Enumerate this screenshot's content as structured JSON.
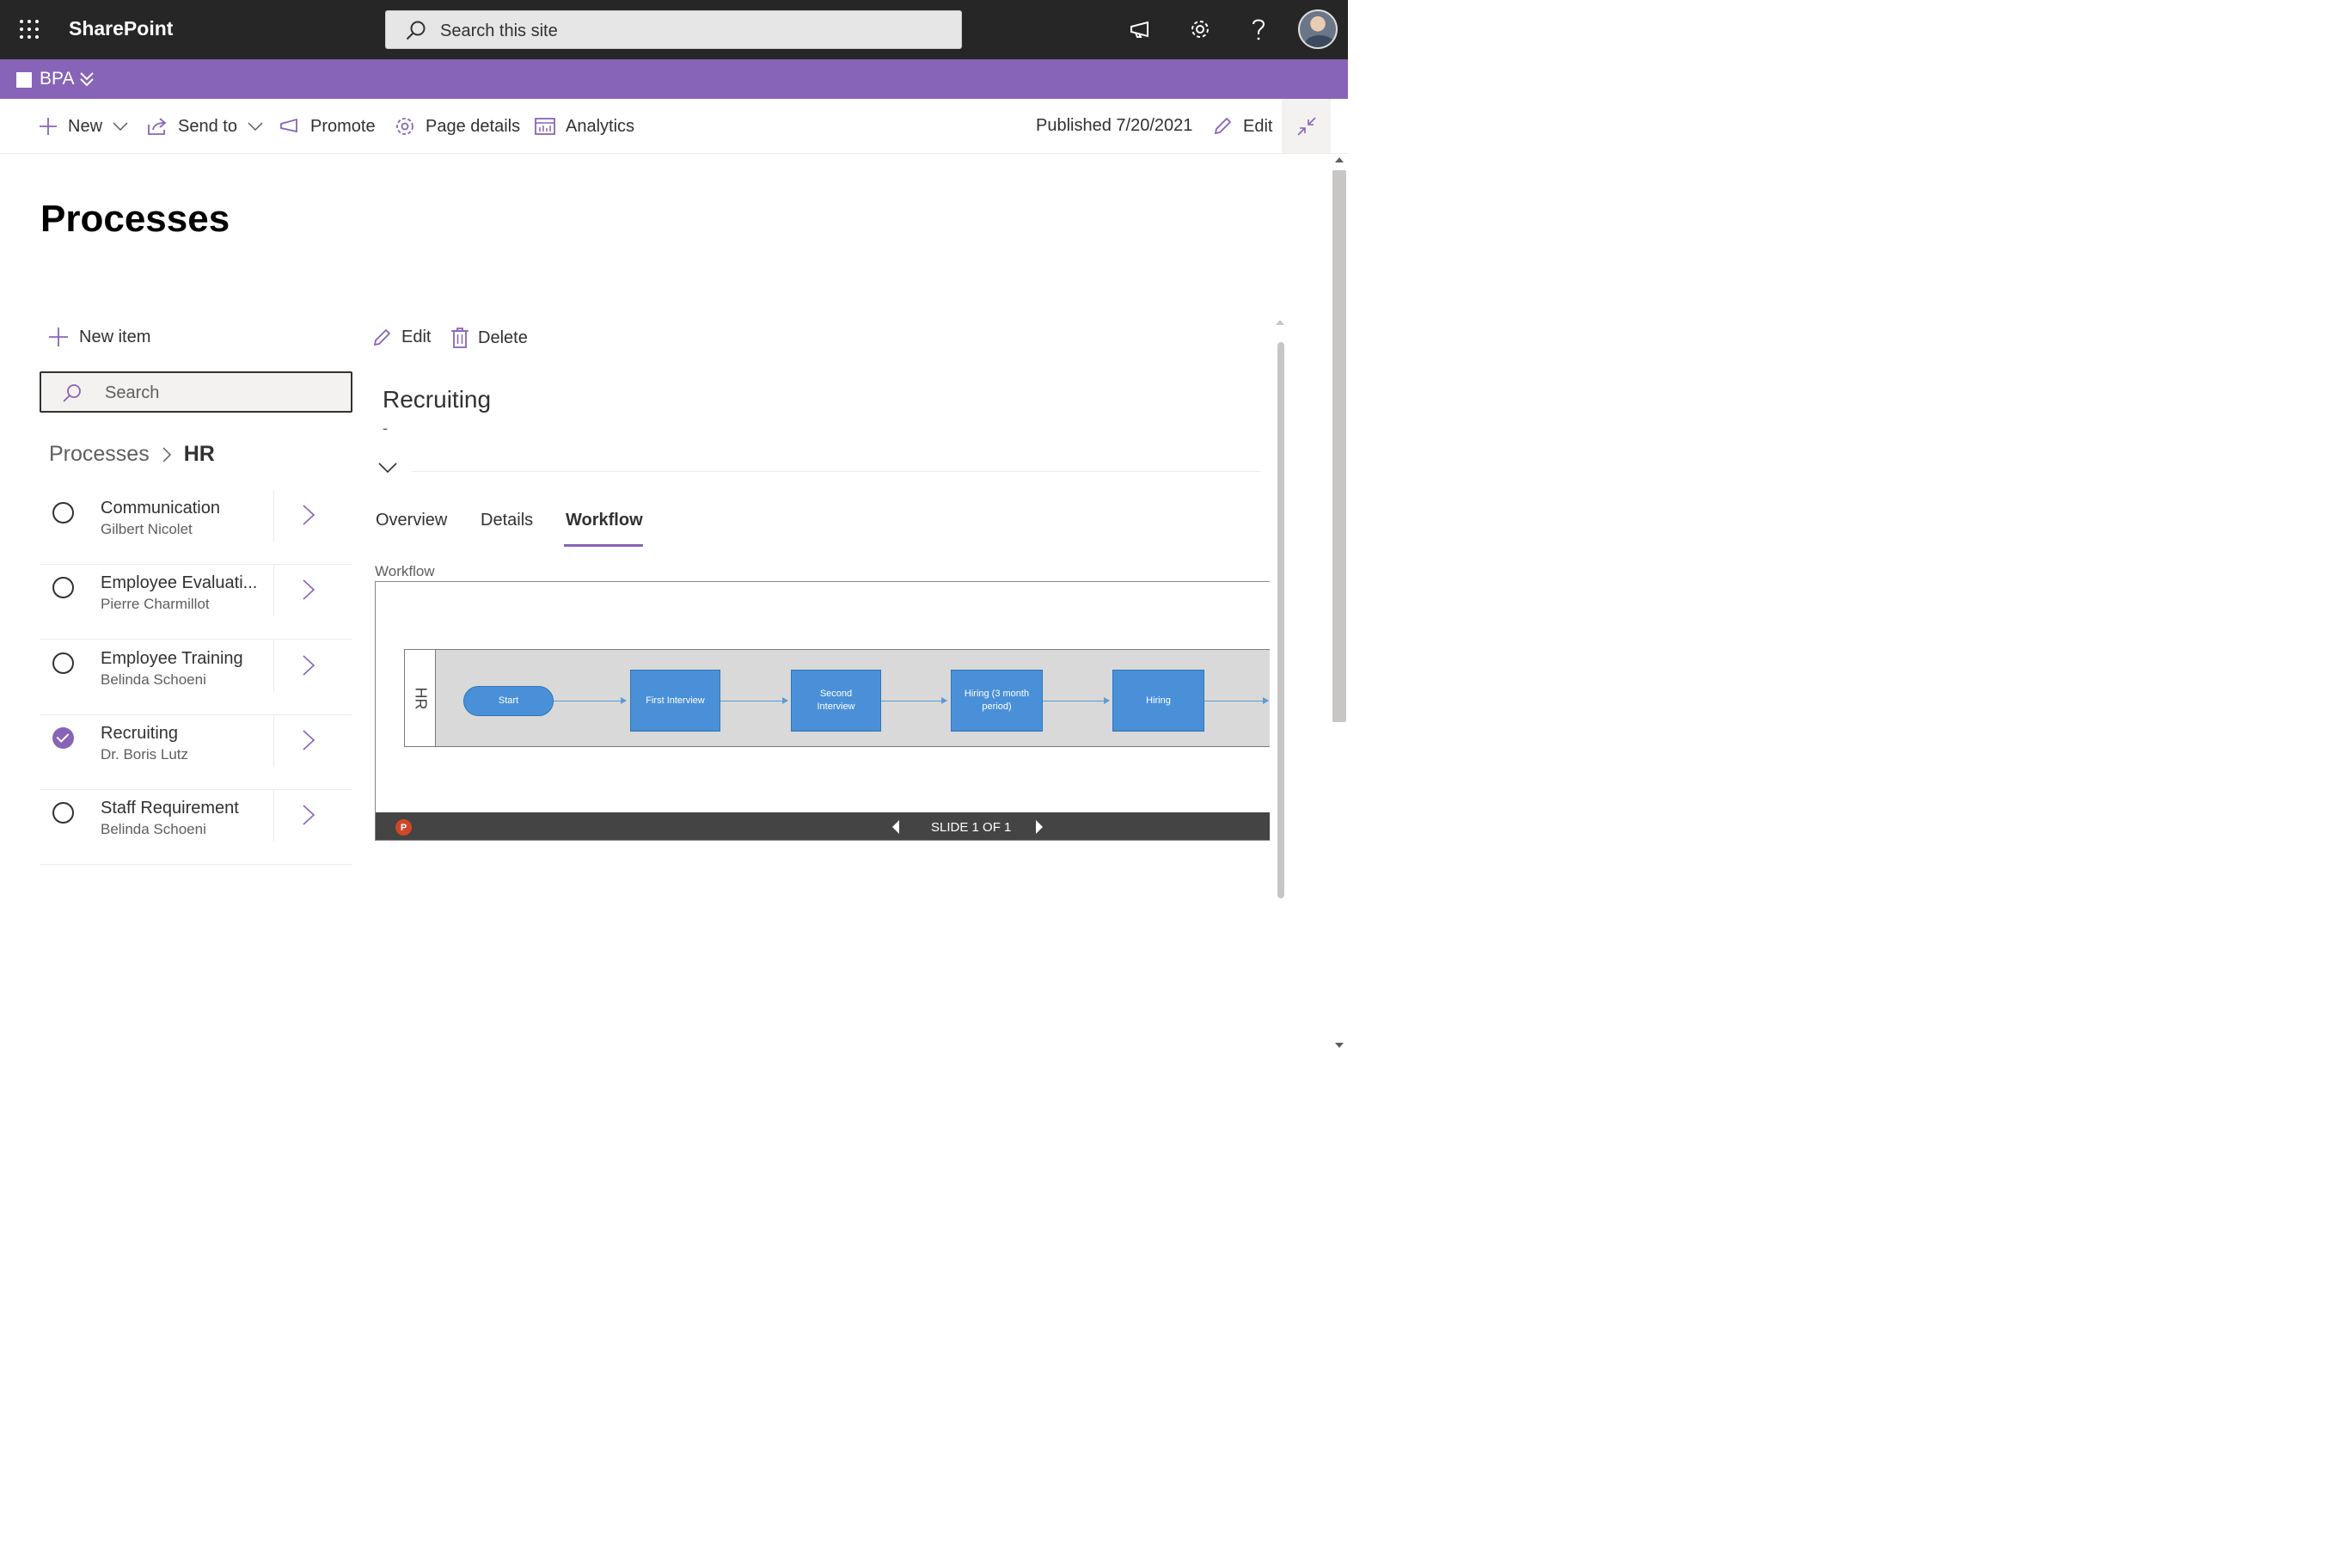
{
  "suite": {
    "brand": "SharePoint",
    "search_placeholder": "Search this site",
    "icons": [
      "app-launcher-icon",
      "megaphone-icon",
      "gear-icon",
      "help-icon",
      "avatar"
    ]
  },
  "hub": {
    "name": "BPA"
  },
  "command_bar": {
    "new": "New",
    "send_to": "Send to",
    "promote": "Promote",
    "page_details": "Page details",
    "analytics": "Analytics",
    "published": "Published 7/20/2021",
    "edit": "Edit"
  },
  "page": {
    "title": "Processes"
  },
  "list": {
    "new_item": "New item",
    "search_placeholder": "Search",
    "breadcrumb": [
      "Processes",
      "HR"
    ],
    "items": [
      {
        "title": "Communication",
        "owner": "Gilbert Nicolet",
        "selected": false
      },
      {
        "title": "Employee Evaluati...",
        "owner": "Pierre Charmillot",
        "selected": false
      },
      {
        "title": "Employee Training",
        "owner": "Belinda Schoeni",
        "selected": false
      },
      {
        "title": "Recruiting",
        "owner": "Dr. Boris Lutz",
        "selected": true
      },
      {
        "title": "Staff Requirement",
        "owner": "Belinda Schoeni",
        "selected": false
      }
    ]
  },
  "detail": {
    "edit": "Edit",
    "delete": "Delete",
    "title": "Recruiting",
    "subtitle": "-",
    "tabs": [
      "Overview",
      "Details",
      "Workflow"
    ],
    "active_tab": "Workflow",
    "workflow_label": "Workflow",
    "diagram": {
      "lane": "HR",
      "steps": [
        "Start",
        "First Interview",
        "Second Interview",
        "Hiring (3 month period)",
        "Hiring"
      ]
    },
    "viewer": {
      "slide_text": "SLIDE 1 OF 1"
    }
  },
  "colors": {
    "suite_bg": "#262626",
    "hub_bg": "#8764b8",
    "accent": "#8764b8",
    "shape_fill": "#4a90d9"
  }
}
